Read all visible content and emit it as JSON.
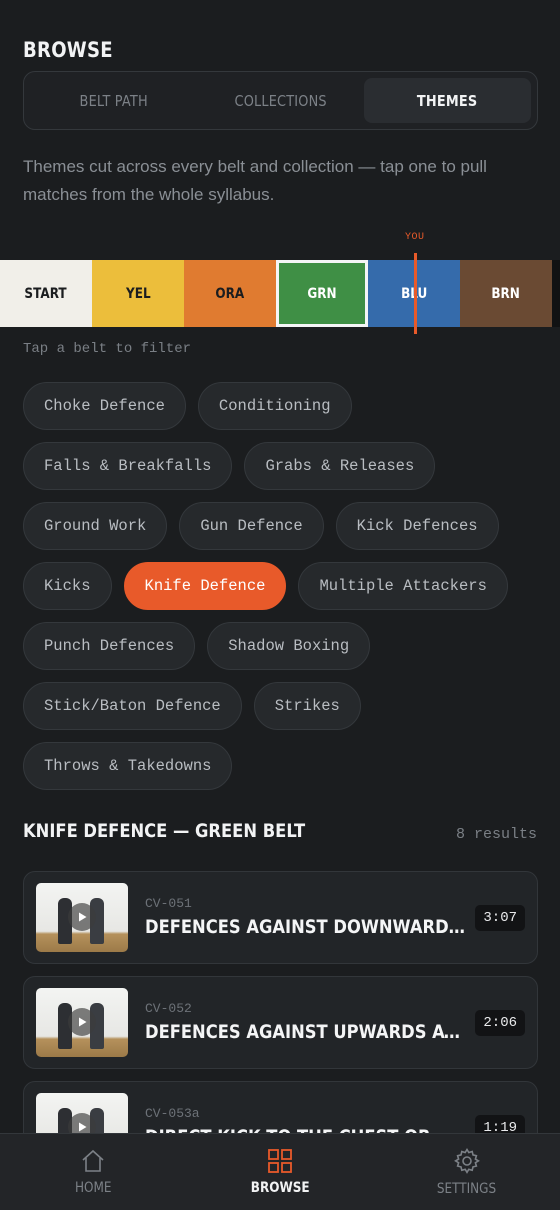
{
  "header": {
    "title": "BROWSE"
  },
  "segments": [
    {
      "label": "BELT PATH",
      "active": false
    },
    {
      "label": "COLLECTIONS",
      "active": false
    },
    {
      "label": "THEMES",
      "active": true
    }
  ],
  "description": "Themes cut across every belt and collection — tap one to pull matches from the whole syllabus.",
  "belt_track": {
    "you_label": "YOU",
    "hint": "Tap a belt to filter",
    "belts": [
      {
        "label": "START",
        "color": "#f1efe9",
        "text_color": "#1b1d1f"
      },
      {
        "label": "YEL",
        "color": "#ecbe3b",
        "text_color": "#1b1d1f"
      },
      {
        "label": "ORA",
        "color": "#e07b30",
        "text_color": "#1b1d1f"
      },
      {
        "label": "GRN",
        "color": "#3f8f45",
        "text_color": "#ffffff",
        "selected": true
      },
      {
        "label": "BLU",
        "color": "#356bab",
        "text_color": "#ffffff"
      },
      {
        "label": "BRN",
        "color": "#6a4a33",
        "text_color": "#ffffff"
      }
    ]
  },
  "themes": [
    {
      "label": "Choke Defence"
    },
    {
      "label": "Conditioning"
    },
    {
      "label": "Falls & Breakfalls"
    },
    {
      "label": "Grabs & Releases"
    },
    {
      "label": "Ground Work"
    },
    {
      "label": "Gun Defence"
    },
    {
      "label": "Kick Defences"
    },
    {
      "label": "Kicks"
    },
    {
      "label": "Knife Defence",
      "active": true
    },
    {
      "label": "Multiple Attackers"
    },
    {
      "label": "Punch Defences"
    },
    {
      "label": "Shadow Boxing"
    },
    {
      "label": "Stick/Baton Defence"
    },
    {
      "label": "Strikes"
    },
    {
      "label": "Throws & Takedowns"
    }
  ],
  "results": {
    "title": "KNIFE DEFENCE — GREEN BELT",
    "count": "8 results",
    "items": [
      {
        "code": "CV-051",
        "title": "DEFENCES AGAINST DOWNWARD STABS",
        "duration": "3:07"
      },
      {
        "code": "CV-052",
        "title": "DEFENCES AGAINST UPWARDS ATTACKS",
        "duration": "2:06"
      },
      {
        "code": "CV-053a",
        "title": "DIRECT KICK TO THE CHEST OR",
        "duration": "1:19"
      }
    ]
  },
  "nav": {
    "home": "HOME",
    "browse": "BROWSE",
    "settings": "SETTINGS"
  },
  "colors": {
    "accent": "#e85a2a",
    "background": "#1b1d1f"
  }
}
